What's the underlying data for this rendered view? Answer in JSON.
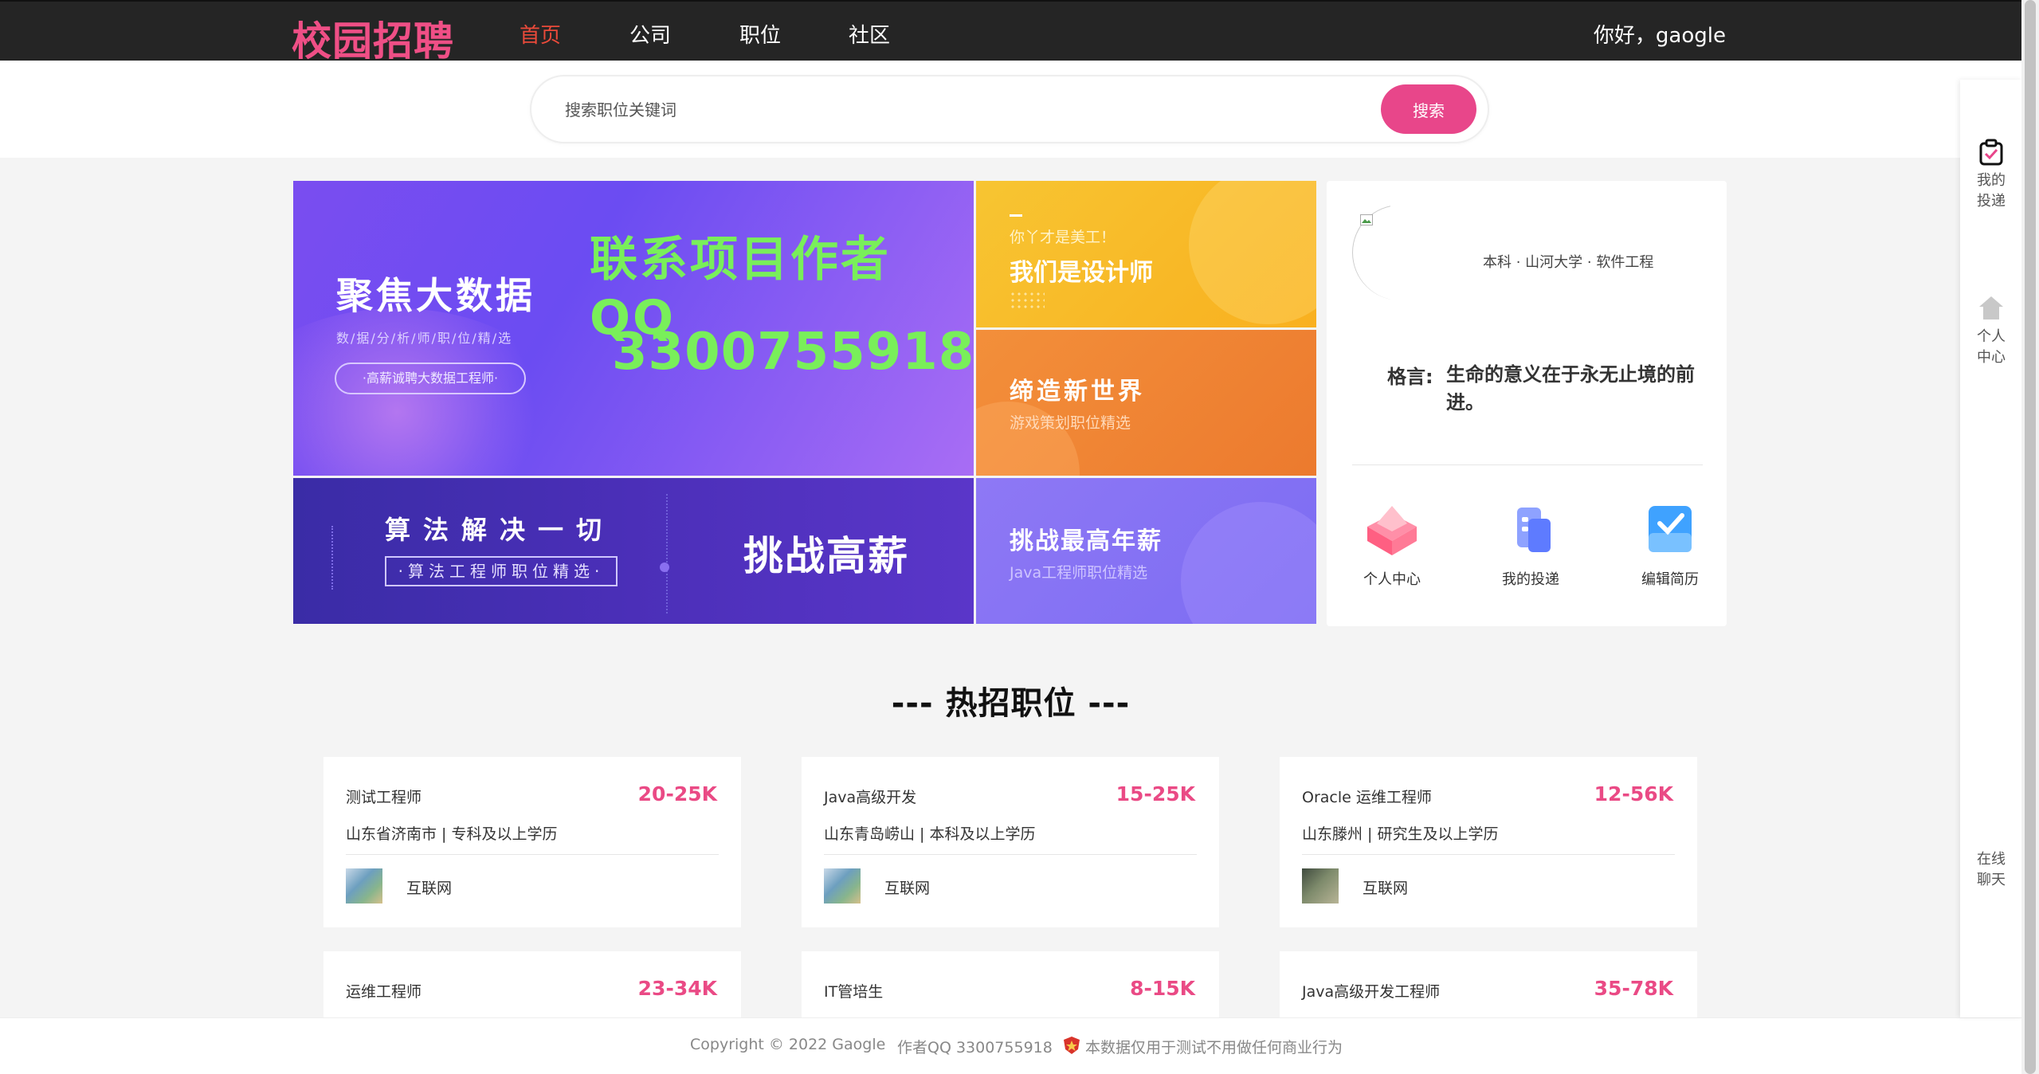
{
  "nav": {
    "logo": "校园招聘",
    "items": [
      "首页",
      "公司",
      "职位",
      "社区"
    ],
    "active_index": 0,
    "greeting": "你好，gaogle"
  },
  "search": {
    "placeholder": "搜索职位关键词",
    "button": "搜索"
  },
  "banners": {
    "big": {
      "title": "聚焦大数据",
      "subtitle": "数/据/分/析/师/职/位/精/选",
      "pill": "·高薪诚聘大数据工程师·",
      "contact_line": "联系项目作者QQ",
      "contact_number": "3300755918"
    },
    "designer": {
      "small": "你丫才是美工！",
      "title": "我们是设计师"
    },
    "game": {
      "title": "缔造新世界",
      "subtitle": "游戏策划职位精选"
    },
    "algo": {
      "title": "算法解决一切",
      "box": "·算法工程师职位精选·",
      "big": "挑战高薪"
    },
    "java": {
      "title": "挑战最高年薪",
      "subtitle": "Java工程师职位精选"
    }
  },
  "profile": {
    "meta": "本科 · 山河大学 · 软件工程",
    "motto_label": "格言:",
    "motto_text": "生命的意义在于永无止境的前进。",
    "quick_actions": [
      "个人中心",
      "我的投递",
      "编辑简历"
    ]
  },
  "section_title": "--- 热招职位 ---",
  "jobs": [
    {
      "name": "测试工程师",
      "salary": "20-25K",
      "location": "山东省济南市 | 专科及以上学历",
      "industry": "互联网"
    },
    {
      "name": "Java高级开发",
      "salary": "15-25K",
      "location": "山东青岛崂山 | 本科及以上学历",
      "industry": "互联网"
    },
    {
      "name": "Oracle 运维工程师",
      "salary": "12-56K",
      "location": "山东滕州 | 研究生及以上学历",
      "industry": "互联网"
    },
    {
      "name": "运维工程师",
      "salary": "23-34K"
    },
    {
      "name": "IT管培生",
      "salary": "8-15K"
    },
    {
      "name": "Java高级开发工程师",
      "salary": "35-78K"
    }
  ],
  "footer": {
    "copyright": "Copyright © 2022 Gaogle",
    "author": "作者QQ 3300755918",
    "disclaimer": "本数据仅用于测试不用做任何商业行为"
  },
  "sidebar": {
    "items": [
      "我的投递",
      "个人中心",
      "在线聊天"
    ]
  },
  "colors": {
    "brand_pink": "#ef4f86",
    "nav_active": "#e94a3a",
    "salary": "#ea4a85",
    "topbar": "#252525"
  }
}
